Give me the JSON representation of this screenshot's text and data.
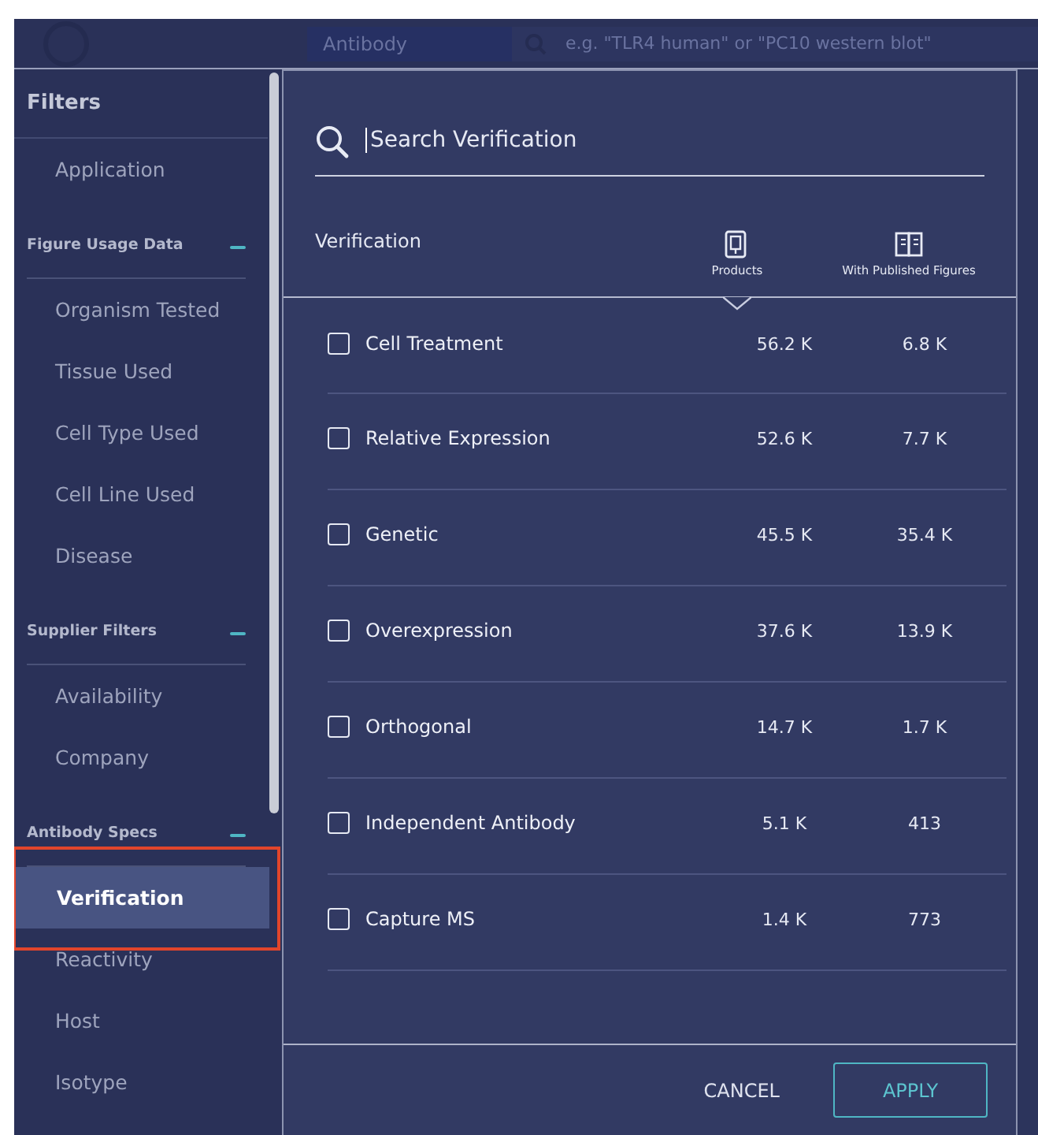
{
  "header": {
    "category": "Antibody",
    "search_placeholder": "e.g. \"TLR4 human\" or \"PC10 western blot\""
  },
  "sidebar": {
    "title": "Filters",
    "groups": [
      {
        "items": [
          {
            "label": "Application",
            "selected": false,
            "highlighted": false
          }
        ]
      },
      {
        "heading": "Figure Usage Data",
        "expanded": true,
        "items": [
          {
            "label": "Organism Tested",
            "selected": false,
            "highlighted": false
          },
          {
            "label": "Tissue Used",
            "selected": false,
            "highlighted": false
          },
          {
            "label": "Cell Type Used",
            "selected": false,
            "highlighted": false
          },
          {
            "label": "Cell Line Used",
            "selected": false,
            "highlighted": false
          },
          {
            "label": "Disease",
            "selected": false,
            "highlighted": false
          }
        ]
      },
      {
        "heading": "Supplier Filters",
        "expanded": true,
        "items": [
          {
            "label": "Availability",
            "selected": false,
            "highlighted": false
          },
          {
            "label": "Company",
            "selected": false,
            "highlighted": false
          }
        ]
      },
      {
        "heading": "Antibody Specs",
        "expanded": true,
        "items": [
          {
            "label": "Verification",
            "selected": true,
            "highlighted": true
          },
          {
            "label": "Reactivity",
            "selected": false,
            "highlighted": false
          },
          {
            "label": "Host",
            "selected": false,
            "highlighted": false
          },
          {
            "label": "Isotype",
            "selected": false,
            "highlighted": false
          }
        ]
      }
    ]
  },
  "modal": {
    "search": {
      "placeholder": "Search Verification",
      "focused": true
    },
    "columns": [
      {
        "label": "Verification",
        "kind": "name"
      },
      {
        "label": "Products",
        "kind": "products",
        "sorted": true
      },
      {
        "label": "With Published Figures",
        "kind": "figures",
        "sorted": false
      }
    ],
    "rows": [
      {
        "label": "Cell Treatment",
        "checked": false,
        "products": "56.2 K",
        "figures": "6.8 K"
      },
      {
        "label": "Relative Expression",
        "checked": false,
        "products": "52.6 K",
        "figures": "7.7 K"
      },
      {
        "label": "Genetic",
        "checked": false,
        "products": "45.5 K",
        "figures": "35.4 K"
      },
      {
        "label": "Overexpression",
        "checked": false,
        "products": "37.6 K",
        "figures": "13.9 K"
      },
      {
        "label": "Orthogonal",
        "checked": false,
        "products": "14.7 K",
        "figures": "1.7 K"
      },
      {
        "label": "Independent Antibody",
        "checked": false,
        "products": "5.1 K",
        "figures": "413"
      },
      {
        "label": "Capture MS",
        "checked": false,
        "products": "1.4 K",
        "figures": "773"
      }
    ],
    "buttons": [
      {
        "label": "CANCEL",
        "kind": "text"
      },
      {
        "label": "APPLY",
        "kind": "outlined"
      }
    ]
  }
}
